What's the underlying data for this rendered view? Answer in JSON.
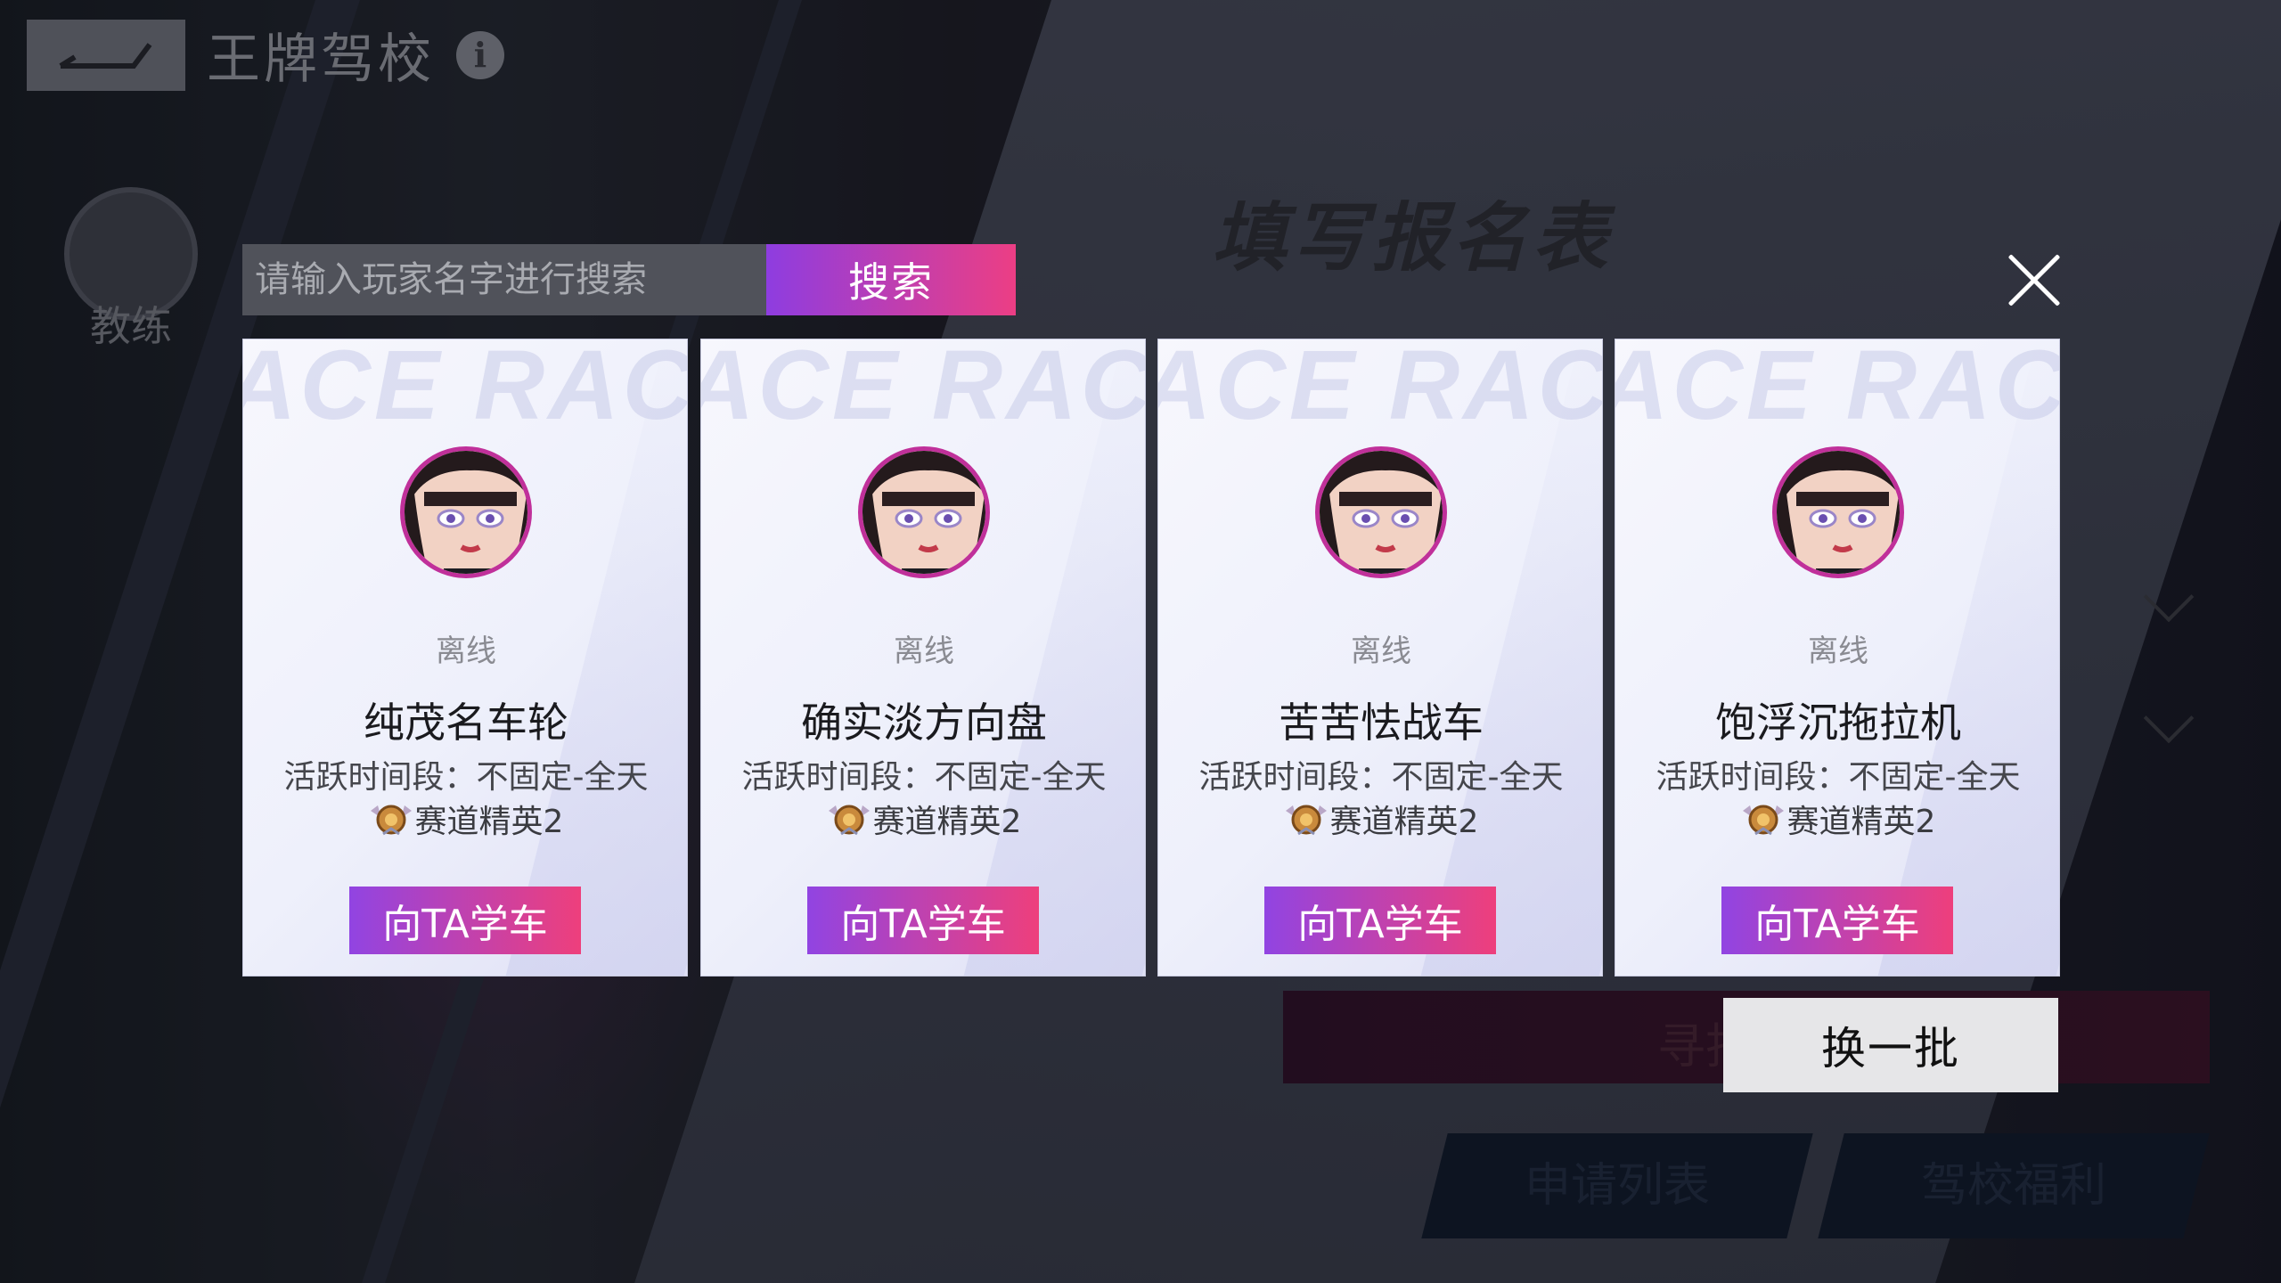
{
  "header": {
    "title": "王牌驾校",
    "info_icon": "i"
  },
  "background": {
    "coach_label": "教练",
    "form_title": "填写报名表",
    "find_button_partial": "寻找",
    "apply_list_label": "申请列表",
    "school_benefits_label": "驾校福利"
  },
  "search": {
    "placeholder": "请输入玩家名字进行搜索",
    "value": "",
    "button_label": "搜索"
  },
  "cards": [
    {
      "status": "离线",
      "name": "纯茂名车轮",
      "active_time": "活跃时间段：不固定-全天",
      "rank": "赛道精英2",
      "button_label": "向TA学车"
    },
    {
      "status": "离线",
      "name": "确实淡方向盘",
      "active_time": "活跃时间段：不固定-全天",
      "rank": "赛道精英2",
      "button_label": "向TA学车"
    },
    {
      "status": "离线",
      "name": "苦苦怯战车",
      "active_time": "活跃时间段：不固定-全天",
      "rank": "赛道精英2",
      "button_label": "向TA学车"
    },
    {
      "status": "离线",
      "name": "饱浮沉拖拉机",
      "active_time": "活跃时间段：不固定-全天",
      "rank": "赛道精英2",
      "button_label": "向TA学车"
    }
  ],
  "card_watermark": "ACE RACER",
  "swap_button_label": "换一批",
  "colors": {
    "accent_start": "#8e3de0",
    "accent_end": "#ec3e84",
    "avatar_border": "#c0309a"
  },
  "icons": {
    "back": "back-arrow-icon",
    "info": "info-icon",
    "close": "close-icon",
    "rank": "rank-badge-icon",
    "coach": "coach-emblem-icon"
  }
}
